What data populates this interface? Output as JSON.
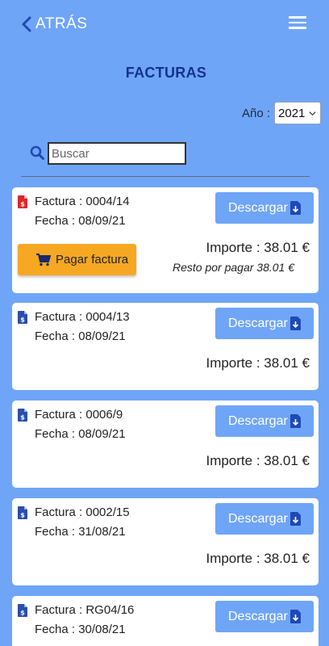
{
  "header": {
    "back_label": "ATRÁS"
  },
  "page_title": "FACTURAS",
  "filters": {
    "year_label": "Año :",
    "year_value": "2021",
    "search_placeholder": "Buscar"
  },
  "download_label": "Descargar",
  "pay_label": "Pagar factura",
  "colors": {
    "background": "#6fa5f7",
    "title": "#15338c",
    "pay_button": "#f6a823",
    "unpaid_icon": "#e0262a",
    "paid_icon": "#2b4fa8"
  },
  "invoices": [
    {
      "factura": "Factura : 0004/14",
      "fecha": "Fecha : 08/09/21",
      "importe": "Importe : 38.01 €",
      "resto": "Resto por pagar 38.01 €",
      "icon": "unpaid-invoice-icon"
    },
    {
      "factura": "Factura : 0004/13",
      "fecha": "Fecha : 08/09/21",
      "importe": "Importe : 38.01 €",
      "icon": "invoice-icon"
    },
    {
      "factura": "Factura : 0006/9",
      "fecha": "Fecha : 08/09/21",
      "importe": "Importe : 38.01 €",
      "icon": "invoice-icon"
    },
    {
      "factura": "Factura : 0002/15",
      "fecha": "Fecha : 31/08/21",
      "importe": "Importe : 38.01 €",
      "icon": "invoice-icon"
    },
    {
      "factura": "Factura : RG04/16",
      "fecha": "Fecha : 30/08/21",
      "icon": "invoice-icon"
    }
  ]
}
